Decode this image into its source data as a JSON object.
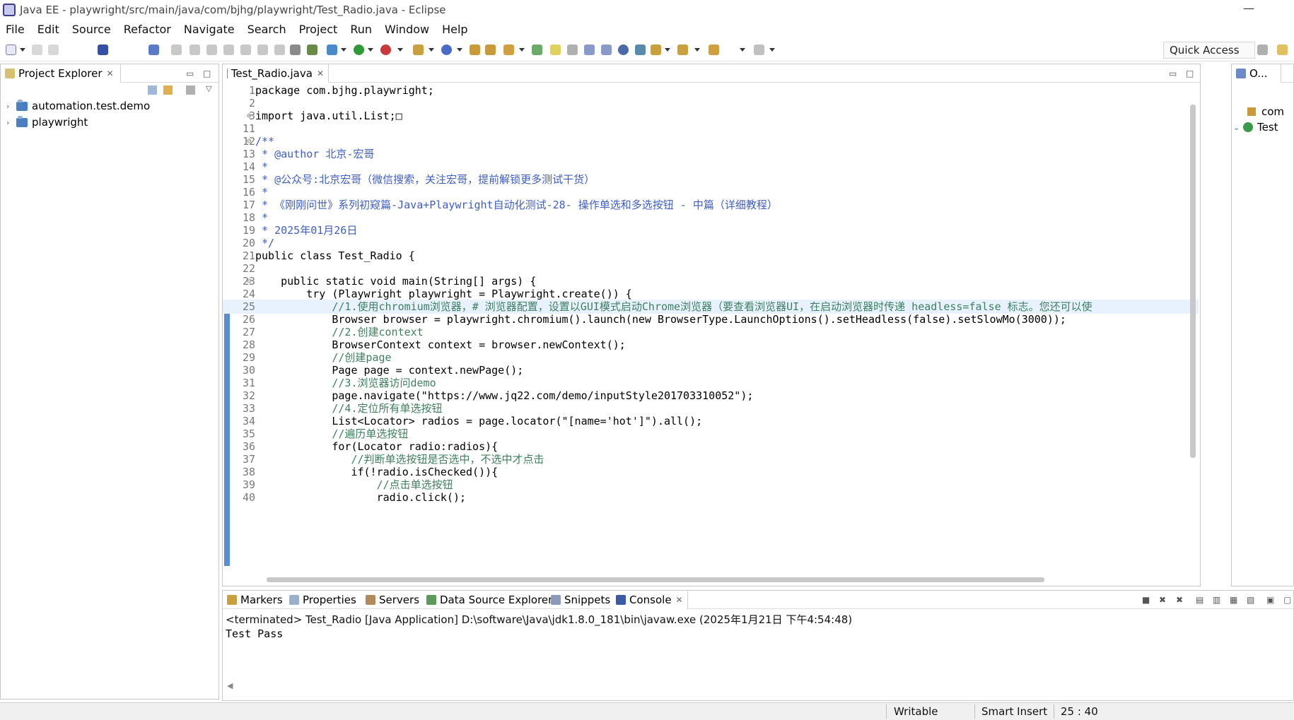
{
  "window": {
    "title": "Java EE - playwright/src/main/java/com/bjhg/playwright/Test_Radio.java - Eclipse"
  },
  "menu": [
    "File",
    "Edit",
    "Source",
    "Refactor",
    "Navigate",
    "Search",
    "Project",
    "Run",
    "Window",
    "Help"
  ],
  "toolbar": {
    "quick_access": "Quick Access"
  },
  "explorer": {
    "tab_label": "Project Explorer",
    "projects": [
      "automation.test.demo",
      "playwright"
    ]
  },
  "editor": {
    "tab_label": "Test_Radio.java",
    "lines": [
      {
        "n": "1",
        "text": "package com.bjhg.playwright;"
      },
      {
        "n": "2",
        "text": ""
      },
      {
        "n": "3",
        "text": "import java.util.List;□"
      },
      {
        "n": "11",
        "text": ""
      },
      {
        "n": "12",
        "text": "/**"
      },
      {
        "n": "13",
        "text": " * @author 北京-宏哥"
      },
      {
        "n": "14",
        "text": " *"
      },
      {
        "n": "15",
        "text": " * @公众号:北京宏哥（微信搜索，关注宏哥，提前解锁更多测试干货）"
      },
      {
        "n": "16",
        "text": " *"
      },
      {
        "n": "17",
        "text": " * 《刚刚问世》系列初窥篇-Java+Playwright自动化测试-28- 操作单选和多选按钮 - 中篇（详细教程）"
      },
      {
        "n": "18",
        "text": " *"
      },
      {
        "n": "19",
        "text": " * 2025年01月26日"
      },
      {
        "n": "20",
        "text": " */"
      },
      {
        "n": "21",
        "text": "public class Test_Radio {"
      },
      {
        "n": "22",
        "text": ""
      },
      {
        "n": "23",
        "text": "    public static void main(String[] args) {"
      },
      {
        "n": "24",
        "text": "        try (Playwright playwright = Playwright.create()) {"
      },
      {
        "n": "25",
        "text": "            //1.使用chromium浏览器，# 浏览器配置，设置以GUI模式启动Chrome浏览器（要查看浏览器UI，在启动浏览器时传递 headless=false 标志。您还可以使"
      },
      {
        "n": "26",
        "text": "            Browser browser = playwright.chromium().launch(new BrowserType.LaunchOptions().setHeadless(false).setSlowMo(3000));"
      },
      {
        "n": "27",
        "text": "            //2.创建context"
      },
      {
        "n": "28",
        "text": "            BrowserContext context = browser.newContext();"
      },
      {
        "n": "29",
        "text": "            //创建page"
      },
      {
        "n": "30",
        "text": "            Page page = context.newPage();"
      },
      {
        "n": "31",
        "text": "            //3.浏览器访问demo"
      },
      {
        "n": "32",
        "text": "            page.navigate(\"https://www.jq22.com/demo/inputStyle201703310052\");"
      },
      {
        "n": "33",
        "text": "            //4.定位所有单选按钮"
      },
      {
        "n": "34",
        "text": "            List<Locator> radios = page.locator(\"[name='hot']\").all();"
      },
      {
        "n": "35",
        "text": "            //遍历单选按钮"
      },
      {
        "n": "36",
        "text": "            for(Locator radio:radios){"
      },
      {
        "n": "37",
        "text": "               //判断单选按钮是否选中，不选中才点击"
      },
      {
        "n": "38",
        "text": "               if(!radio.isChecked()){"
      },
      {
        "n": "39",
        "text": "                   //点击单选按钮"
      },
      {
        "n": "40",
        "text": "                   radio.click();"
      }
    ]
  },
  "outline": {
    "tab_label": "O...",
    "items": [
      "com",
      "Test"
    ]
  },
  "console": {
    "tabs": [
      "Markers",
      "Properties",
      "Servers",
      "Data Source Explorer",
      "Snippets",
      "Console"
    ],
    "header": "<terminated> Test_Radio [Java Application] D:\\software\\Java\\jdk1.8.0_181\\bin\\javaw.exe (2025年1月21日 下午4:54:48)",
    "output": "Test Pass"
  },
  "status": {
    "writable": "Writable",
    "insert_mode": "Smart Insert",
    "position": "25 : 40"
  }
}
